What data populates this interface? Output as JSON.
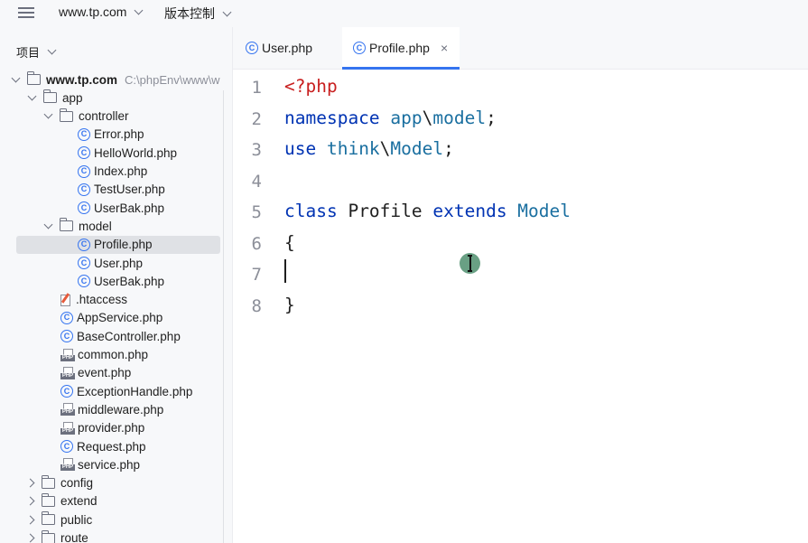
{
  "topbar": {
    "project_name": "www.tp.com",
    "vcs_label": "版本控制"
  },
  "sidebar": {
    "header_label": "项目",
    "root": {
      "name": "www.tp.com",
      "path_hint": "C:\\phpEnv\\www\\w"
    },
    "tree": [
      {
        "name": "app",
        "type": "folder",
        "expanded": true,
        "depth": 1
      },
      {
        "name": "controller",
        "type": "folder",
        "expanded": true,
        "depth": 2
      },
      {
        "name": "Error.php",
        "type": "class",
        "depth": 3
      },
      {
        "name": "HelloWorld.php",
        "type": "class",
        "depth": 3
      },
      {
        "name": "Index.php",
        "type": "class",
        "depth": 3
      },
      {
        "name": "TestUser.php",
        "type": "class",
        "depth": 3
      },
      {
        "name": "UserBak.php",
        "type": "class",
        "depth": 3
      },
      {
        "name": "model",
        "type": "folder",
        "expanded": true,
        "depth": 2
      },
      {
        "name": "Profile.php",
        "type": "class",
        "depth": 3,
        "selected": true
      },
      {
        "name": "User.php",
        "type": "class",
        "depth": 3
      },
      {
        "name": "UserBak.php",
        "type": "class",
        "depth": 3
      },
      {
        "name": ".htaccess",
        "type": "htaccess",
        "depth": 2
      },
      {
        "name": "AppService.php",
        "type": "class",
        "depth": 2
      },
      {
        "name": "BaseController.php",
        "type": "class",
        "depth": 2
      },
      {
        "name": "common.php",
        "type": "php",
        "depth": 2
      },
      {
        "name": "event.php",
        "type": "php",
        "depth": 2
      },
      {
        "name": "ExceptionHandle.php",
        "type": "class",
        "depth": 2
      },
      {
        "name": "middleware.php",
        "type": "php",
        "depth": 2
      },
      {
        "name": "provider.php",
        "type": "php",
        "depth": 2
      },
      {
        "name": "Request.php",
        "type": "class",
        "depth": 2
      },
      {
        "name": "service.php",
        "type": "php",
        "depth": 2
      },
      {
        "name": "config",
        "type": "folder",
        "expanded": false,
        "depth": 1
      },
      {
        "name": "extend",
        "type": "folder",
        "expanded": false,
        "depth": 1
      },
      {
        "name": "public",
        "type": "folder",
        "expanded": false,
        "depth": 1
      },
      {
        "name": "route",
        "type": "folder",
        "expanded": false,
        "depth": 1
      }
    ]
  },
  "tabs": [
    {
      "label": "User.php",
      "active": false
    },
    {
      "label": "Profile.php",
      "active": true,
      "close": "×"
    }
  ],
  "editor": {
    "line_numbers": [
      "1",
      "2",
      "3",
      "4",
      "5",
      "6",
      "7",
      "8"
    ],
    "lines": [
      [
        {
          "t": "<?php",
          "c": "tag"
        }
      ],
      [
        {
          "t": "namespace ",
          "c": "kw"
        },
        {
          "t": "app",
          "c": "ns"
        },
        {
          "t": "\\",
          "c": ""
        },
        {
          "t": "model",
          "c": "ns"
        },
        {
          "t": ";",
          "c": ""
        }
      ],
      [
        {
          "t": "use ",
          "c": "kw"
        },
        {
          "t": "think",
          "c": "ns"
        },
        {
          "t": "\\",
          "c": ""
        },
        {
          "t": "Model",
          "c": "cls"
        },
        {
          "t": ";",
          "c": ""
        }
      ],
      [],
      [
        {
          "t": "class ",
          "c": "kw"
        },
        {
          "t": "Profile ",
          "c": ""
        },
        {
          "t": "extends ",
          "c": "kw"
        },
        {
          "t": "Model",
          "c": "cls"
        }
      ],
      [
        {
          "t": "{",
          "c": ""
        }
      ],
      [],
      [
        {
          "t": "}",
          "c": ""
        }
      ]
    ]
  },
  "colors": {
    "accent": "#3574f0",
    "keyword": "#0033b3",
    "php_tag": "#c81f1f",
    "namespace": "#1a6fa0",
    "selection": "#dfe1e5"
  }
}
